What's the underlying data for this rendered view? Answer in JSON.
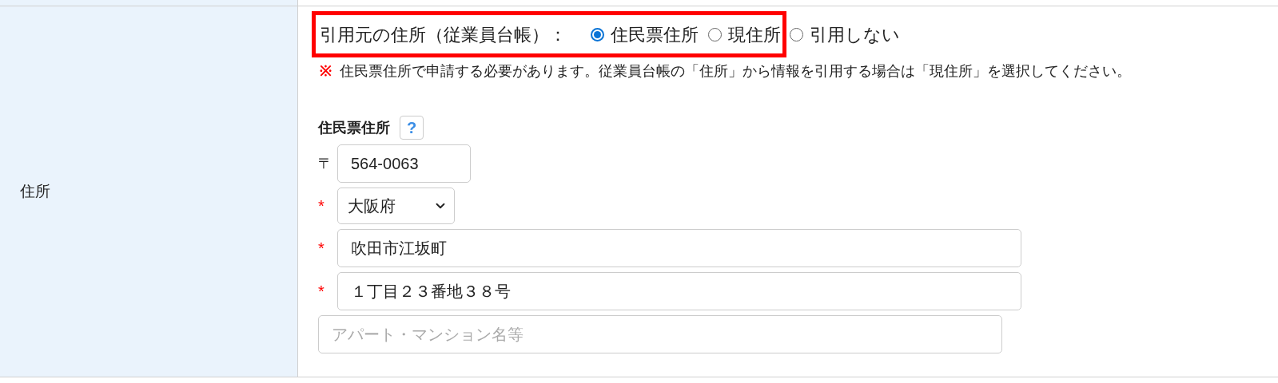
{
  "row": {
    "label": "住所"
  },
  "source": {
    "label": "引用元の住所（従業員台帳）：",
    "options": [
      {
        "label": "住民票住所",
        "selected": true
      },
      {
        "label": "現住所",
        "selected": false
      },
      {
        "label": "引用しない",
        "selected": false
      }
    ]
  },
  "note": {
    "mark": "※",
    "text": "住民票住所で申請する必要があります。従業員台帳の「住所」から情報を引用する場合は「現住所」を選択してください。"
  },
  "section": {
    "title": "住民票住所",
    "help": "?"
  },
  "postal": {
    "symbol": "〒",
    "value": "564-0063"
  },
  "fields": [
    {
      "kind": "select",
      "required": true,
      "value": "大阪府"
    },
    {
      "kind": "text",
      "required": true,
      "value": "吹田市江坂町"
    },
    {
      "kind": "text",
      "required": true,
      "value": "１丁目２３番地３８号"
    },
    {
      "kind": "text",
      "required": false,
      "placeholder": "アパート・マンション名等"
    }
  ],
  "required_mark": "*"
}
